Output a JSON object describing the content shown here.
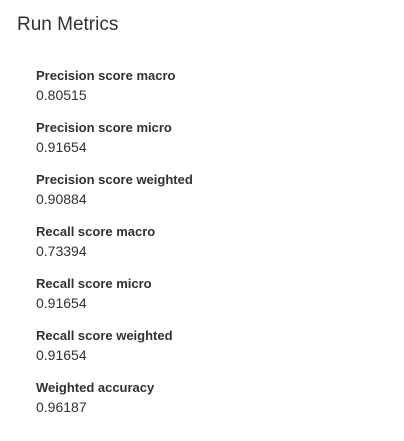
{
  "panel": {
    "title": "Run Metrics"
  },
  "metrics": [
    {
      "label": "Precision score macro",
      "value": "0.80515"
    },
    {
      "label": "Precision score micro",
      "value": "0.91654"
    },
    {
      "label": "Precision score weighted",
      "value": "0.90884"
    },
    {
      "label": "Recall score macro",
      "value": "0.73394"
    },
    {
      "label": "Recall score micro",
      "value": "0.91654"
    },
    {
      "label": "Recall score weighted",
      "value": "0.91654"
    },
    {
      "label": "Weighted accuracy",
      "value": "0.96187"
    }
  ],
  "colors": {
    "text": "#323130",
    "background": "#ffffff"
  }
}
